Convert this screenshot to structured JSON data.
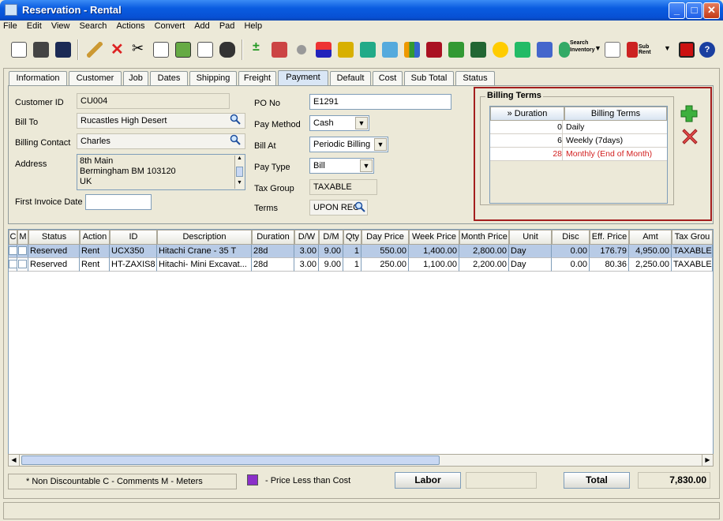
{
  "window": {
    "title": "Reservation - Rental"
  },
  "menu": [
    "File",
    "Edit",
    "View",
    "Search",
    "Actions",
    "Convert",
    "Add",
    "Pad",
    "Help"
  ],
  "toolbar": {
    "search_inventory_label_1": "Search",
    "search_inventory_label_2": "Inventory",
    "sub_rent_label": "Sub Rent"
  },
  "tabs": [
    "Information",
    "Customer",
    "Job",
    "Dates",
    "Shipping",
    "Freight",
    "Payment",
    "Default",
    "Cost",
    "Sub Total",
    "Status"
  ],
  "active_tab": "Payment",
  "form": {
    "customer_id_label": "Customer ID",
    "customer_id": "CU004",
    "bill_to_label": "Bill To",
    "bill_to": "Rucastles High Desert",
    "billing_contact_label": "Billing Contact",
    "billing_contact": "Charles",
    "address_label": "Address",
    "address_line1": "8th Main",
    "address_line2": "Bermingham BM 103120",
    "address_line3": "UK",
    "first_invoice_label": "First Invoice Date",
    "first_invoice": "",
    "po_label": "PO No",
    "po": "E1291",
    "pay_method_label": "Pay Method",
    "pay_method": "Cash",
    "bill_at_label": "Bill At",
    "bill_at": "Periodic Billing",
    "pay_type_label": "Pay Type",
    "pay_type": "Bill",
    "tax_group_label": "Tax Group",
    "tax_group": "TAXABLE",
    "terms_label": "Terms",
    "terms": "UPON REC"
  },
  "billing_terms": {
    "title": "Billing Terms",
    "col_duration": "» Duration",
    "col_terms": "Billing Terms",
    "rows": [
      {
        "duration": "0",
        "terms": "Daily"
      },
      {
        "duration": "6",
        "terms": "Weekly (7days)"
      },
      {
        "duration": "28",
        "terms": "Monthly (End of Month)"
      }
    ]
  },
  "grid": {
    "headers": [
      "C",
      "M",
      "Status",
      "Action",
      "ID",
      "Description",
      "Duration",
      "D/W",
      "D/M",
      "Qty",
      "Day Price",
      "Week Price",
      "Month Price",
      "Unit",
      "Disc",
      "Eff. Price",
      "Amt",
      "Tax Grou"
    ],
    "rows": [
      [
        "",
        "",
        "Reserved",
        "Rent",
        "UCX350",
        "Hitachi Crane - 35 T",
        "28d",
        "3.00",
        "9.00",
        "1",
        "550.00",
        "1,400.00",
        "2,800.00",
        "Day",
        "0.00",
        "176.79",
        "4,950.00",
        "TAXABLE"
      ],
      [
        "",
        "",
        "Reserved",
        "Rent",
        "HT-ZAXIS8",
        "Hitachi- Mini Excavat...",
        "28d",
        "3.00",
        "9.00",
        "1",
        "250.00",
        "1,100.00",
        "2,200.00",
        "Day",
        "0.00",
        "80.36",
        "2,250.00",
        "TAXABLE"
      ]
    ]
  },
  "footer": {
    "legend": "* Non Discountable  C - Comments  M - Meters",
    "price_note": "- Price Less than Cost",
    "price_note_color": "#8b2fc9",
    "labor_label": "Labor",
    "labor_value": "",
    "total_label": "Total",
    "total_value": "7,830.00"
  }
}
